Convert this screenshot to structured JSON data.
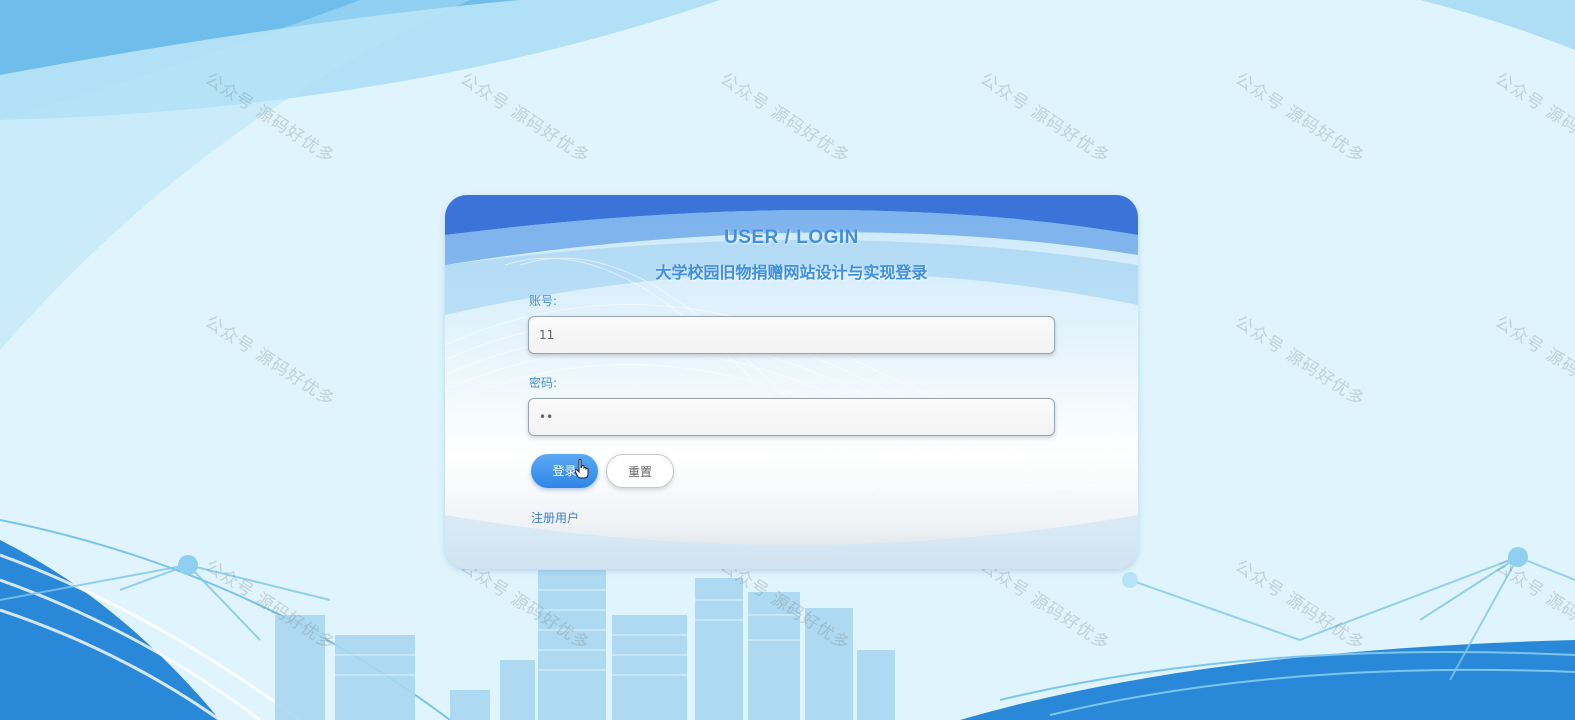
{
  "login": {
    "title": "USER / LOGIN",
    "subtitle": "大学校园旧物捐赠网站设计与实现登录",
    "account_label": "账号:",
    "account_value": "11",
    "password_label": "密码:",
    "password_value": "••",
    "login_button": "登录",
    "reset_button": "重置",
    "register_link": "注册用户"
  },
  "watermark_text": "公众号 源码好优多",
  "colors": {
    "accent": "#3f8ee0",
    "background": "#dff4fc",
    "button": "#2f86e6"
  }
}
